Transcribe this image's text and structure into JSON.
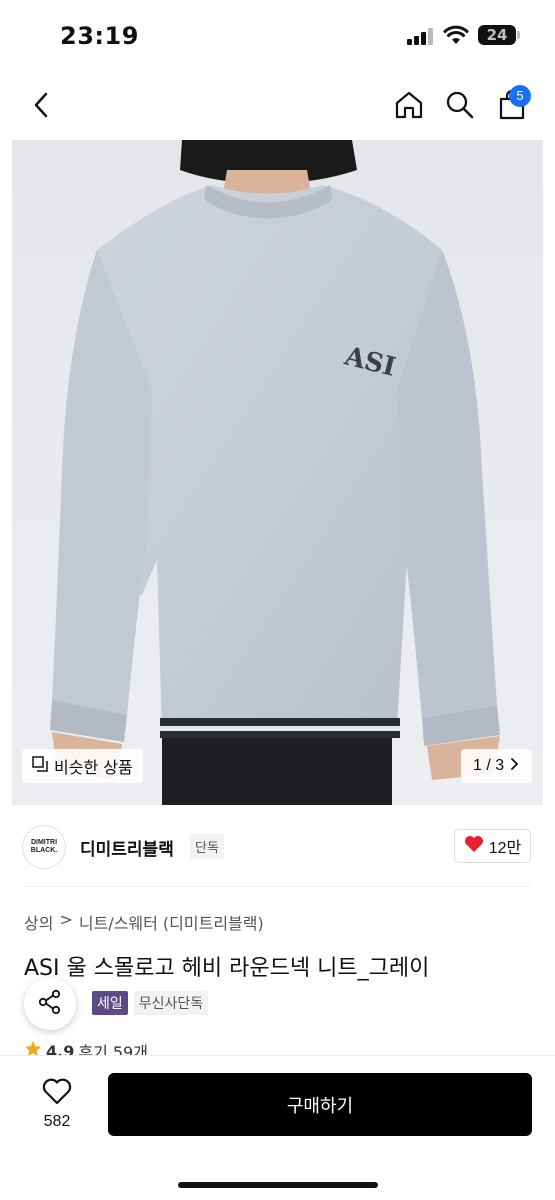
{
  "status_bar": {
    "time": "23:19",
    "battery_level": "24",
    "icons": [
      "signal-icon",
      "wifi-icon",
      "battery-icon"
    ]
  },
  "nav": {
    "icons": [
      "back-icon",
      "home-icon",
      "search-icon",
      "cart-icon"
    ],
    "cart_count": "5"
  },
  "product_image": {
    "logo_text": "ASI",
    "similar_label": "비슷한 상품",
    "page_indicator": "1 / 3",
    "sweater_color": "#c9ced6"
  },
  "brand": {
    "logo_line1": "DIMITRI",
    "logo_line2": "BLACK.",
    "name": "디미트리블랙",
    "tag": "단독",
    "likes": "12만"
  },
  "breadcrumb": {
    "level1": "상의",
    "separator": ">",
    "level2": "니트/스웨터 (디미트리블랙)"
  },
  "product": {
    "title": "ASI 울 스몰로고 헤비 라운드넥 니트_그레이",
    "badge_sale": "세일",
    "badge_exclusive": "무신사단독",
    "rating": "4.9",
    "reviews": "후기 59개"
  },
  "bottom_bar": {
    "wish_count": "582",
    "buy_label": "구매하기"
  },
  "colors": {
    "accent_blue": "#1d6ff2",
    "heart_red": "#e8202e",
    "star_orange": "#f5a623",
    "sale_purple": "#5b4a86"
  }
}
